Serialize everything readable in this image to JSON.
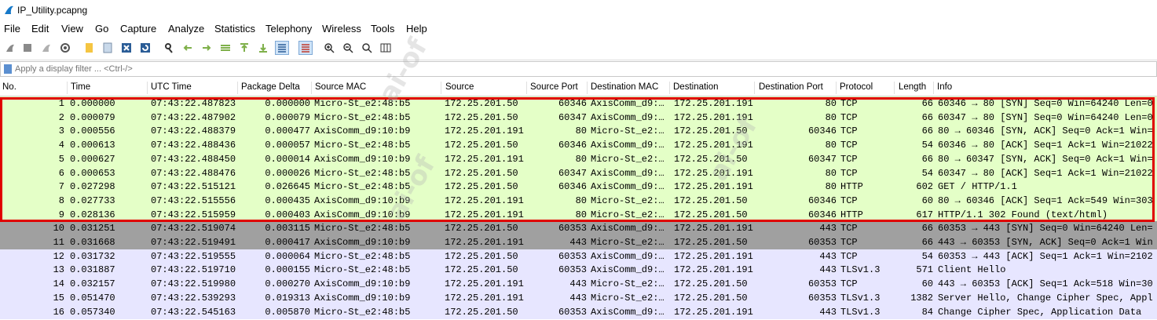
{
  "window": {
    "title": "IP_Utility.pcapng"
  },
  "menu": [
    "File",
    "Edit",
    "View",
    "Go",
    "Capture",
    "Analyze",
    "Statistics",
    "Telephony",
    "Wireless",
    "Tools",
    "Help"
  ],
  "filter": {
    "placeholder": "Apply a display filter ... <Ctrl-/>"
  },
  "columns": [
    "No.",
    "Time",
    "UTC Time",
    "Package Delta",
    "Source MAC",
    "Source",
    "Source Port",
    "Destination MAC",
    "Destination",
    "Destination Port",
    "Protocol",
    "Length",
    "Info"
  ],
  "packets": [
    {
      "no": "1",
      "time": "0.000000",
      "utc": "07:43:22.487823",
      "delta": "0.000000",
      "smac": "Micro-St_e2:48:b5",
      "src": "172.25.201.50",
      "sport": "60346",
      "dmac": "AxisComm_d9:…",
      "dst": "172.25.201.191",
      "dport": "80",
      "proto": "TCP",
      "len": "66",
      "info": "60346 → 80 [SYN] Seq=0 Win=64240 Len=0",
      "bg": "#e4ffc7"
    },
    {
      "no": "2",
      "time": "0.000079",
      "utc": "07:43:22.487902",
      "delta": "0.000079",
      "smac": "Micro-St_e2:48:b5",
      "src": "172.25.201.50",
      "sport": "60347",
      "dmac": "AxisComm_d9:…",
      "dst": "172.25.201.191",
      "dport": "80",
      "proto": "TCP",
      "len": "66",
      "info": "60347 → 80 [SYN] Seq=0 Win=64240 Len=0",
      "bg": "#e4ffc7"
    },
    {
      "no": "3",
      "time": "0.000556",
      "utc": "07:43:22.488379",
      "delta": "0.000477",
      "smac": "AxisComm_d9:10:b9",
      "src": "172.25.201.191",
      "sport": "80",
      "dmac": "Micro-St_e2:…",
      "dst": "172.25.201.50",
      "dport": "60346",
      "proto": "TCP",
      "len": "66",
      "info": "80 → 60346 [SYN, ACK] Seq=0 Ack=1 Win=",
      "bg": "#e4ffc7"
    },
    {
      "no": "4",
      "time": "0.000613",
      "utc": "07:43:22.488436",
      "delta": "0.000057",
      "smac": "Micro-St_e2:48:b5",
      "src": "172.25.201.50",
      "sport": "60346",
      "dmac": "AxisComm_d9:…",
      "dst": "172.25.201.191",
      "dport": "80",
      "proto": "TCP",
      "len": "54",
      "info": "60346 → 80 [ACK] Seq=1 Ack=1 Win=21022",
      "bg": "#e4ffc7"
    },
    {
      "no": "5",
      "time": "0.000627",
      "utc": "07:43:22.488450",
      "delta": "0.000014",
      "smac": "AxisComm_d9:10:b9",
      "src": "172.25.201.191",
      "sport": "80",
      "dmac": "Micro-St_e2:…",
      "dst": "172.25.201.50",
      "dport": "60347",
      "proto": "TCP",
      "len": "66",
      "info": "80 → 60347 [SYN, ACK] Seq=0 Ack=1 Win=",
      "bg": "#e4ffc7"
    },
    {
      "no": "6",
      "time": "0.000653",
      "utc": "07:43:22.488476",
      "delta": "0.000026",
      "smac": "Micro-St_e2:48:b5",
      "src": "172.25.201.50",
      "sport": "60347",
      "dmac": "AxisComm_d9:…",
      "dst": "172.25.201.191",
      "dport": "80",
      "proto": "TCP",
      "len": "54",
      "info": "60347 → 80 [ACK] Seq=1 Ack=1 Win=21022",
      "bg": "#e4ffc7"
    },
    {
      "no": "7",
      "time": "0.027298",
      "utc": "07:43:22.515121",
      "delta": "0.026645",
      "smac": "Micro-St_e2:48:b5",
      "src": "172.25.201.50",
      "sport": "60346",
      "dmac": "AxisComm_d9:…",
      "dst": "172.25.201.191",
      "dport": "80",
      "proto": "HTTP",
      "len": "602",
      "info": "GET / HTTP/1.1",
      "bg": "#e4ffc7"
    },
    {
      "no": "8",
      "time": "0.027733",
      "utc": "07:43:22.515556",
      "delta": "0.000435",
      "smac": "AxisComm_d9:10:b9",
      "src": "172.25.201.191",
      "sport": "80",
      "dmac": "Micro-St_e2:…",
      "dst": "172.25.201.50",
      "dport": "60346",
      "proto": "TCP",
      "len": "60",
      "info": "80 → 60346 [ACK] Seq=1 Ack=549 Win=303",
      "bg": "#e4ffc7"
    },
    {
      "no": "9",
      "time": "0.028136",
      "utc": "07:43:22.515959",
      "delta": "0.000403",
      "smac": "AxisComm_d9:10:b9",
      "src": "172.25.201.191",
      "sport": "80",
      "dmac": "Micro-St_e2:…",
      "dst": "172.25.201.50",
      "dport": "60346",
      "proto": "HTTP",
      "len": "617",
      "info": "HTTP/1.1 302 Found  (text/html)",
      "bg": "#e4ffc7"
    },
    {
      "no": "10",
      "time": "0.031251",
      "utc": "07:43:22.519074",
      "delta": "0.003115",
      "smac": "Micro-St_e2:48:b5",
      "src": "172.25.201.50",
      "sport": "60353",
      "dmac": "AxisComm_d9:…",
      "dst": "172.25.201.191",
      "dport": "443",
      "proto": "TCP",
      "len": "66",
      "info": "60353 → 443 [SYN] Seq=0 Win=64240 Len=",
      "bg": "#a0a0a0"
    },
    {
      "no": "11",
      "time": "0.031668",
      "utc": "07:43:22.519491",
      "delta": "0.000417",
      "smac": "AxisComm_d9:10:b9",
      "src": "172.25.201.191",
      "sport": "443",
      "dmac": "Micro-St_e2:…",
      "dst": "172.25.201.50",
      "dport": "60353",
      "proto": "TCP",
      "len": "66",
      "info": "443 → 60353 [SYN, ACK] Seq=0 Ack=1 Win",
      "bg": "#a0a0a0"
    },
    {
      "no": "12",
      "time": "0.031732",
      "utc": "07:43:22.519555",
      "delta": "0.000064",
      "smac": "Micro-St_e2:48:b5",
      "src": "172.25.201.50",
      "sport": "60353",
      "dmac": "AxisComm_d9:…",
      "dst": "172.25.201.191",
      "dport": "443",
      "proto": "TCP",
      "len": "54",
      "info": "60353 → 443 [ACK] Seq=1 Ack=1 Win=2102",
      "bg": "#e7e6ff"
    },
    {
      "no": "13",
      "time": "0.031887",
      "utc": "07:43:22.519710",
      "delta": "0.000155",
      "smac": "Micro-St_e2:48:b5",
      "src": "172.25.201.50",
      "sport": "60353",
      "dmac": "AxisComm_d9:…",
      "dst": "172.25.201.191",
      "dport": "443",
      "proto": "TLSv1.3",
      "len": "571",
      "info": "Client Hello",
      "bg": "#e7e6ff"
    },
    {
      "no": "14",
      "time": "0.032157",
      "utc": "07:43:22.519980",
      "delta": "0.000270",
      "smac": "AxisComm_d9:10:b9",
      "src": "172.25.201.191",
      "sport": "443",
      "dmac": "Micro-St_e2:…",
      "dst": "172.25.201.50",
      "dport": "60353",
      "proto": "TCP",
      "len": "60",
      "info": "443 → 60353 [ACK] Seq=1 Ack=518 Win=30",
      "bg": "#e7e6ff"
    },
    {
      "no": "15",
      "time": "0.051470",
      "utc": "07:43:22.539293",
      "delta": "0.019313",
      "smac": "AxisComm_d9:10:b9",
      "src": "172.25.201.191",
      "sport": "443",
      "dmac": "Micro-St_e2:…",
      "dst": "172.25.201.50",
      "dport": "60353",
      "proto": "TLSv1.3",
      "len": "1382",
      "info": "Server Hello, Change Cipher Spec, Appl",
      "bg": "#e7e6ff"
    },
    {
      "no": "16",
      "time": "0.057340",
      "utc": "07:43:22.545163",
      "delta": "0.005870",
      "smac": "Micro-St_e2:48:b5",
      "src": "172.25.201.50",
      "sport": "60353",
      "dmac": "AxisComm_d9:…",
      "dst": "172.25.201.191",
      "dport": "443",
      "proto": "TLSv1.3",
      "len": "84",
      "info": "Change Cipher Spec, Application Data",
      "bg": "#e7e6ff"
    }
  ]
}
